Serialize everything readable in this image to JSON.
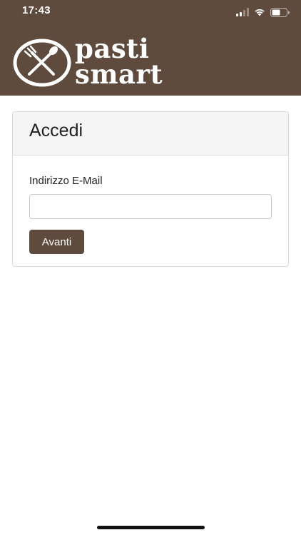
{
  "status_bar": {
    "time": "17:43"
  },
  "brand": {
    "line1": "pasti",
    "line2": "smart",
    "header_color": "#5f4b3d"
  },
  "login_card": {
    "title": "Accedi",
    "email_label": "Indirizzo E-Mail",
    "email_value": "",
    "submit_label": "Avanti"
  },
  "icons": [
    "signal-icon",
    "wifi-icon",
    "battery-icon",
    "spoon-fork-icon"
  ]
}
